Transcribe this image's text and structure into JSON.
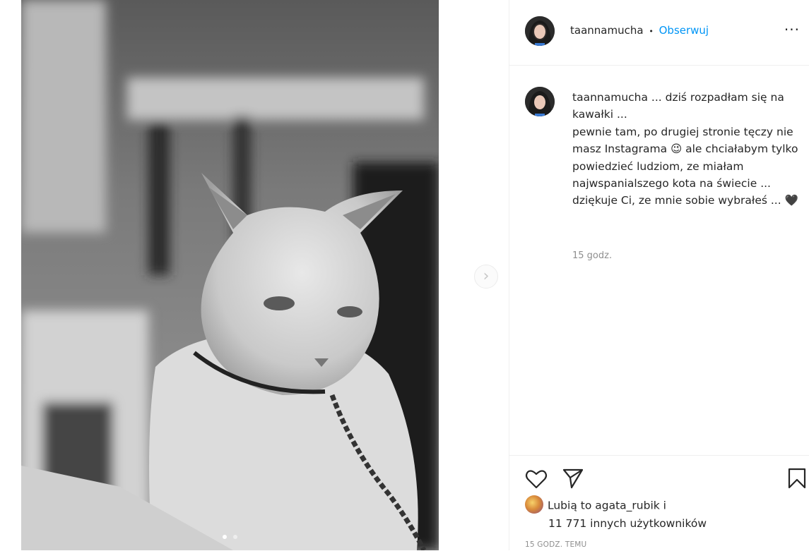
{
  "post": {
    "username": "taannamucha",
    "follow_separator": "•",
    "follow_label": "Obserwuj",
    "more_label": "···"
  },
  "caption": {
    "username": "taannamucha",
    "text": " ... dziś rozpadłam się na kawałki ...\npewnie tam, po drugiej stronie tęczy nie masz Instagrama 😉 ale chciałabym tylko powiedzieć ludziom, ze miałam najwspanialszego kota na świecie ... dziękuje Ci, ze mnie sobie wybrałeś ... 🖤",
    "time": "15 godz."
  },
  "likes": {
    "prefix": "Lubią to ",
    "user": "agata_rubik",
    "suffix": " i",
    "others": "11 771 innych użytkowników"
  },
  "post_time": "15 GODZ. TEMU",
  "icons": {
    "like": "heart-icon",
    "share": "paper-plane-icon",
    "save": "bookmark-icon",
    "next": "chevron-right-icon",
    "more": "more-options-icon"
  },
  "carousel": {
    "slides": 2,
    "current": 1
  },
  "colors": {
    "link": "#0095f6",
    "secondary_text": "#8e8e8e",
    "border": "#efefef"
  }
}
